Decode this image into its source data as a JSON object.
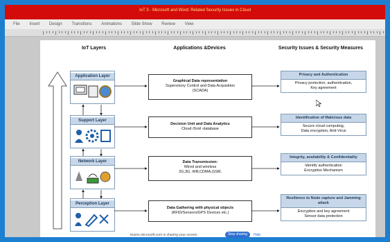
{
  "window": {
    "title": "IoT 3 - Microsoft and Word: Related Security Issues in Cloud"
  },
  "menu": [
    "File",
    "Insert",
    "Design",
    "Transitions",
    "Animations",
    "Slide Show",
    "Review",
    "View"
  ],
  "headers": {
    "col1": "IoT Layers",
    "col2": "Applications &Devices",
    "col3": "Security Issues  & Security Measures"
  },
  "layers": [
    {
      "label": "Application Layer"
    },
    {
      "label": "Support Layer"
    },
    {
      "label": "Network Layer"
    },
    {
      "label": "Perception Layer"
    }
  ],
  "apps": [
    {
      "title": "Graphical Data representation",
      "line2": "Supervisory Control and Data Acquisition",
      "line3": "(SCADA)"
    },
    {
      "title": "Decision Unit and Data Analytics",
      "line2": "Cloud /Grid -database",
      "line3": ""
    },
    {
      "title": "Data Transmission:",
      "line2": "Wired and wireless",
      "line3": "2G,3G, Wifi,CDMA,GSM,"
    },
    {
      "title": "Data Gathering with physical objects",
      "line2": "(RFID/Sensors/GPS Devices etc.)",
      "line3": ""
    }
  ],
  "security": [
    {
      "head": "Privacy and Authentication",
      "body1": "Privacy protection, authentication,",
      "body2": "Key agreement"
    },
    {
      "head": "Identification of Malicious data",
      "body1": "Secure cloud computing,",
      "body2": "Data encryption, Anti-Virus"
    },
    {
      "head": "Integrity, availability & Confidentiality",
      "body1": "Identify authentication",
      "body2": "Encryption Mechanism"
    },
    {
      "head": "Resilience to Node capture and Jamming attack",
      "body1": "Encryption and key agreement",
      "body2": "Sensor data protection"
    }
  ],
  "share_bar": {
    "text": "teams.microsoft.com is sharing your screen.",
    "stop": "Stop sharing",
    "hide": "Hide"
  },
  "colors": {
    "titlebar": "#d40b0b",
    "frame": "#1d7fd0",
    "layer_fill": "#c7d7e9"
  }
}
